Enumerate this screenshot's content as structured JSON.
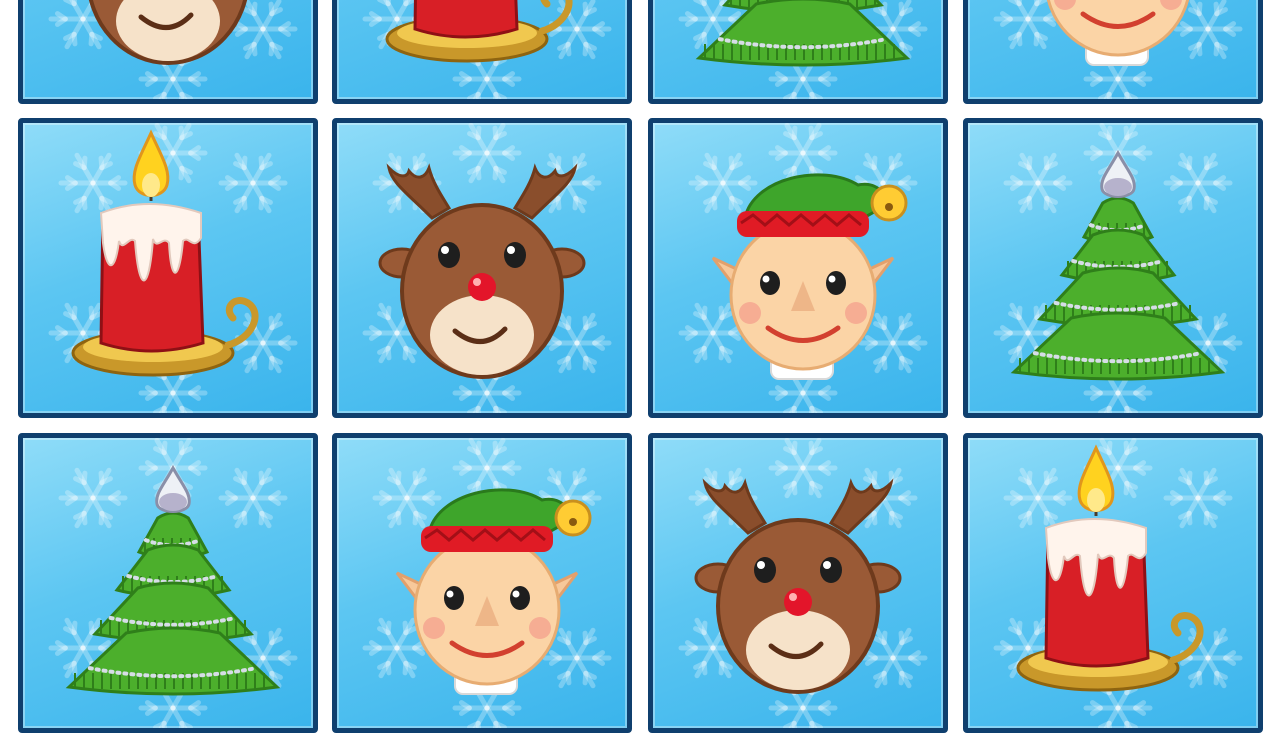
{
  "game": {
    "tiles": [
      {
        "row": 0,
        "col": 0,
        "icon": "reindeer"
      },
      {
        "row": 0,
        "col": 1,
        "icon": "candle"
      },
      {
        "row": 0,
        "col": 2,
        "icon": "christmas-tree"
      },
      {
        "row": 0,
        "col": 3,
        "icon": "elf"
      },
      {
        "row": 1,
        "col": 0,
        "icon": "candle"
      },
      {
        "row": 1,
        "col": 1,
        "icon": "reindeer"
      },
      {
        "row": 1,
        "col": 2,
        "icon": "elf"
      },
      {
        "row": 1,
        "col": 3,
        "icon": "christmas-tree"
      },
      {
        "row": 2,
        "col": 0,
        "icon": "christmas-tree"
      },
      {
        "row": 2,
        "col": 1,
        "icon": "elf"
      },
      {
        "row": 2,
        "col": 2,
        "icon": "reindeer"
      },
      {
        "row": 2,
        "col": 3,
        "icon": "candle"
      }
    ]
  },
  "colors": {
    "tile_border": "#0f3f6e",
    "tile_blue": "#5cc6f2",
    "reindeer_brown": "#9a5a36",
    "elf_hat_green": "#3ea52b",
    "elf_hat_red": "#e01b25",
    "tree_green": "#4caf2c",
    "candle_red": "#d81f26",
    "flame_yellow": "#ffd21f"
  }
}
